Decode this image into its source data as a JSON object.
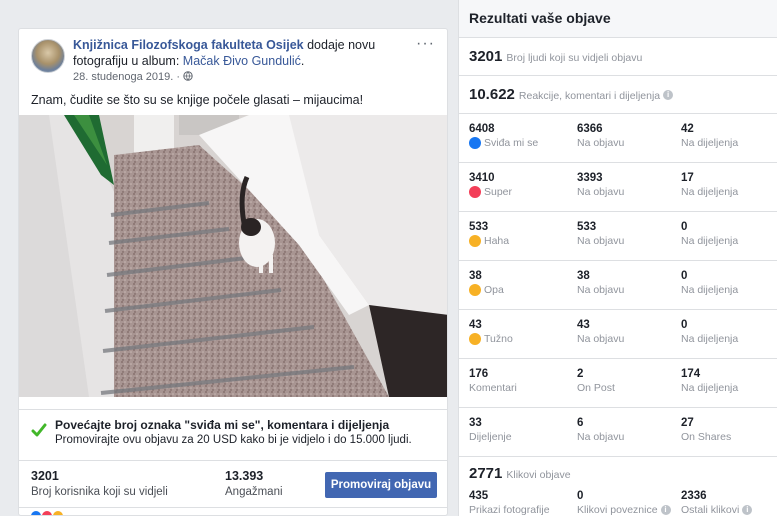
{
  "post": {
    "page_name": "Knjižnica Filozofskoga fakulteta Osijek",
    "action_text": " dodaje novu fotografiju u album: ",
    "album_name": "Mačak Đivo Gundulić",
    "album_end": ".",
    "date": "28. studenoga 2019. · ",
    "more": "···",
    "caption": "Znam, čudite se što su se knjige počele glasati – mijaucima!"
  },
  "promo": {
    "title": "Povećajte broj oznaka \"sviđa mi se\", komentara i dijeljenja",
    "subtitle": "Promovirajte ovu objavu za 20 USD kako bi je vidjelo i do 15.000 ljudi."
  },
  "stats": {
    "reach_value": "3201",
    "reach_label": "Broj korisnika koji su vidjeli",
    "engagement_value": "13.393",
    "engagement_label": "Angažmani",
    "promote_button": "Promoviraj objavu"
  },
  "results": {
    "title": "Rezultati vaše objave",
    "reach_value": "3201",
    "reach_label": "Broj ljudi koji su vidjeli objavu",
    "reactions_value": "10.622",
    "reactions_label": "Reakcije, komentari i dijeljenja",
    "rows": [
      {
        "total": "6408",
        "label": "Sviđa mi se",
        "on_post": "6366",
        "on_post_label": "Na objavu",
        "on_shares": "42",
        "on_shares_label": "Na dijeljenja",
        "icon": "like-icon",
        "color": "#1877f2"
      },
      {
        "total": "3410",
        "label": "Super",
        "on_post": "3393",
        "on_post_label": "Na objavu",
        "on_shares": "17",
        "on_shares_label": "Na dijeljenja",
        "icon": "love-icon",
        "color": "#f33e58"
      },
      {
        "total": "533",
        "label": "Haha",
        "on_post": "533",
        "on_post_label": "Na objavu",
        "on_shares": "0",
        "on_shares_label": "Na dijeljenja",
        "icon": "haha-icon",
        "color": "#f7b125"
      },
      {
        "total": "38",
        "label": "Opa",
        "on_post": "38",
        "on_post_label": "Na objavu",
        "on_shares": "0",
        "on_shares_label": "Na dijeljenja",
        "icon": "wow-icon",
        "color": "#f7b125"
      },
      {
        "total": "43",
        "label": "Tužno",
        "on_post": "43",
        "on_post_label": "Na objavu",
        "on_shares": "0",
        "on_shares_label": "Na dijeljenja",
        "icon": "sad-icon",
        "color": "#f7b125"
      },
      {
        "total": "176",
        "label": "Komentari",
        "on_post": "2",
        "on_post_label": "On Post",
        "on_shares": "174",
        "on_shares_label": "Na dijeljenja",
        "icon": "",
        "color": ""
      },
      {
        "total": "33",
        "label": "Dijeljenje",
        "on_post": "6",
        "on_post_label": "Na objavu",
        "on_shares": "27",
        "on_shares_label": "On Shares",
        "icon": "",
        "color": ""
      }
    ],
    "clicks_value": "2771",
    "clicks_label": "Klikovi objave",
    "clicks": {
      "photo_views": "435",
      "photo_views_label": "Prikazi fotografije",
      "link_clicks": "0",
      "link_clicks_label": "Klikovi poveznice",
      "other_clicks": "2336",
      "other_clicks_label": "Ostali klikovi"
    }
  },
  "colors": {
    "accent": "#4267b2",
    "link": "#385898",
    "check": "#42b72a"
  }
}
